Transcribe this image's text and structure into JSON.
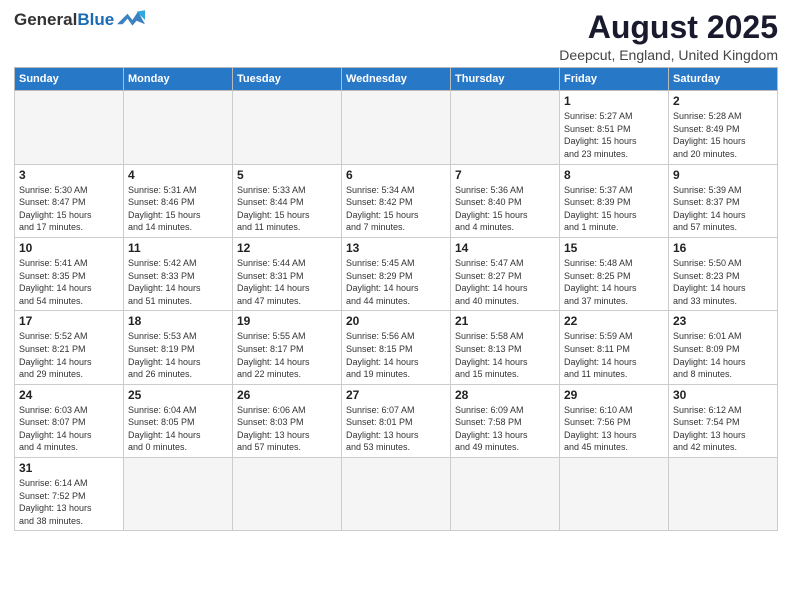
{
  "header": {
    "logo_general": "General",
    "logo_blue": "Blue",
    "title": "August 2025",
    "subtitle": "Deepcut, England, United Kingdom"
  },
  "weekdays": [
    "Sunday",
    "Monday",
    "Tuesday",
    "Wednesday",
    "Thursday",
    "Friday",
    "Saturday"
  ],
  "weeks": [
    [
      {
        "day": "",
        "info": ""
      },
      {
        "day": "",
        "info": ""
      },
      {
        "day": "",
        "info": ""
      },
      {
        "day": "",
        "info": ""
      },
      {
        "day": "",
        "info": ""
      },
      {
        "day": "1",
        "info": "Sunrise: 5:27 AM\nSunset: 8:51 PM\nDaylight: 15 hours\nand 23 minutes."
      },
      {
        "day": "2",
        "info": "Sunrise: 5:28 AM\nSunset: 8:49 PM\nDaylight: 15 hours\nand 20 minutes."
      }
    ],
    [
      {
        "day": "3",
        "info": "Sunrise: 5:30 AM\nSunset: 8:47 PM\nDaylight: 15 hours\nand 17 minutes."
      },
      {
        "day": "4",
        "info": "Sunrise: 5:31 AM\nSunset: 8:46 PM\nDaylight: 15 hours\nand 14 minutes."
      },
      {
        "day": "5",
        "info": "Sunrise: 5:33 AM\nSunset: 8:44 PM\nDaylight: 15 hours\nand 11 minutes."
      },
      {
        "day": "6",
        "info": "Sunrise: 5:34 AM\nSunset: 8:42 PM\nDaylight: 15 hours\nand 7 minutes."
      },
      {
        "day": "7",
        "info": "Sunrise: 5:36 AM\nSunset: 8:40 PM\nDaylight: 15 hours\nand 4 minutes."
      },
      {
        "day": "8",
        "info": "Sunrise: 5:37 AM\nSunset: 8:39 PM\nDaylight: 15 hours\nand 1 minute."
      },
      {
        "day": "9",
        "info": "Sunrise: 5:39 AM\nSunset: 8:37 PM\nDaylight: 14 hours\nand 57 minutes."
      }
    ],
    [
      {
        "day": "10",
        "info": "Sunrise: 5:41 AM\nSunset: 8:35 PM\nDaylight: 14 hours\nand 54 minutes."
      },
      {
        "day": "11",
        "info": "Sunrise: 5:42 AM\nSunset: 8:33 PM\nDaylight: 14 hours\nand 51 minutes."
      },
      {
        "day": "12",
        "info": "Sunrise: 5:44 AM\nSunset: 8:31 PM\nDaylight: 14 hours\nand 47 minutes."
      },
      {
        "day": "13",
        "info": "Sunrise: 5:45 AM\nSunset: 8:29 PM\nDaylight: 14 hours\nand 44 minutes."
      },
      {
        "day": "14",
        "info": "Sunrise: 5:47 AM\nSunset: 8:27 PM\nDaylight: 14 hours\nand 40 minutes."
      },
      {
        "day": "15",
        "info": "Sunrise: 5:48 AM\nSunset: 8:25 PM\nDaylight: 14 hours\nand 37 minutes."
      },
      {
        "day": "16",
        "info": "Sunrise: 5:50 AM\nSunset: 8:23 PM\nDaylight: 14 hours\nand 33 minutes."
      }
    ],
    [
      {
        "day": "17",
        "info": "Sunrise: 5:52 AM\nSunset: 8:21 PM\nDaylight: 14 hours\nand 29 minutes."
      },
      {
        "day": "18",
        "info": "Sunrise: 5:53 AM\nSunset: 8:19 PM\nDaylight: 14 hours\nand 26 minutes."
      },
      {
        "day": "19",
        "info": "Sunrise: 5:55 AM\nSunset: 8:17 PM\nDaylight: 14 hours\nand 22 minutes."
      },
      {
        "day": "20",
        "info": "Sunrise: 5:56 AM\nSunset: 8:15 PM\nDaylight: 14 hours\nand 19 minutes."
      },
      {
        "day": "21",
        "info": "Sunrise: 5:58 AM\nSunset: 8:13 PM\nDaylight: 14 hours\nand 15 minutes."
      },
      {
        "day": "22",
        "info": "Sunrise: 5:59 AM\nSunset: 8:11 PM\nDaylight: 14 hours\nand 11 minutes."
      },
      {
        "day": "23",
        "info": "Sunrise: 6:01 AM\nSunset: 8:09 PM\nDaylight: 14 hours\nand 8 minutes."
      }
    ],
    [
      {
        "day": "24",
        "info": "Sunrise: 6:03 AM\nSunset: 8:07 PM\nDaylight: 14 hours\nand 4 minutes."
      },
      {
        "day": "25",
        "info": "Sunrise: 6:04 AM\nSunset: 8:05 PM\nDaylight: 14 hours\nand 0 minutes."
      },
      {
        "day": "26",
        "info": "Sunrise: 6:06 AM\nSunset: 8:03 PM\nDaylight: 13 hours\nand 57 minutes."
      },
      {
        "day": "27",
        "info": "Sunrise: 6:07 AM\nSunset: 8:01 PM\nDaylight: 13 hours\nand 53 minutes."
      },
      {
        "day": "28",
        "info": "Sunrise: 6:09 AM\nSunset: 7:58 PM\nDaylight: 13 hours\nand 49 minutes."
      },
      {
        "day": "29",
        "info": "Sunrise: 6:10 AM\nSunset: 7:56 PM\nDaylight: 13 hours\nand 45 minutes."
      },
      {
        "day": "30",
        "info": "Sunrise: 6:12 AM\nSunset: 7:54 PM\nDaylight: 13 hours\nand 42 minutes."
      }
    ],
    [
      {
        "day": "31",
        "info": "Sunrise: 6:14 AM\nSunset: 7:52 PM\nDaylight: 13 hours\nand 38 minutes."
      },
      {
        "day": "",
        "info": ""
      },
      {
        "day": "",
        "info": ""
      },
      {
        "day": "",
        "info": ""
      },
      {
        "day": "",
        "info": ""
      },
      {
        "day": "",
        "info": ""
      },
      {
        "day": "",
        "info": ""
      }
    ]
  ]
}
